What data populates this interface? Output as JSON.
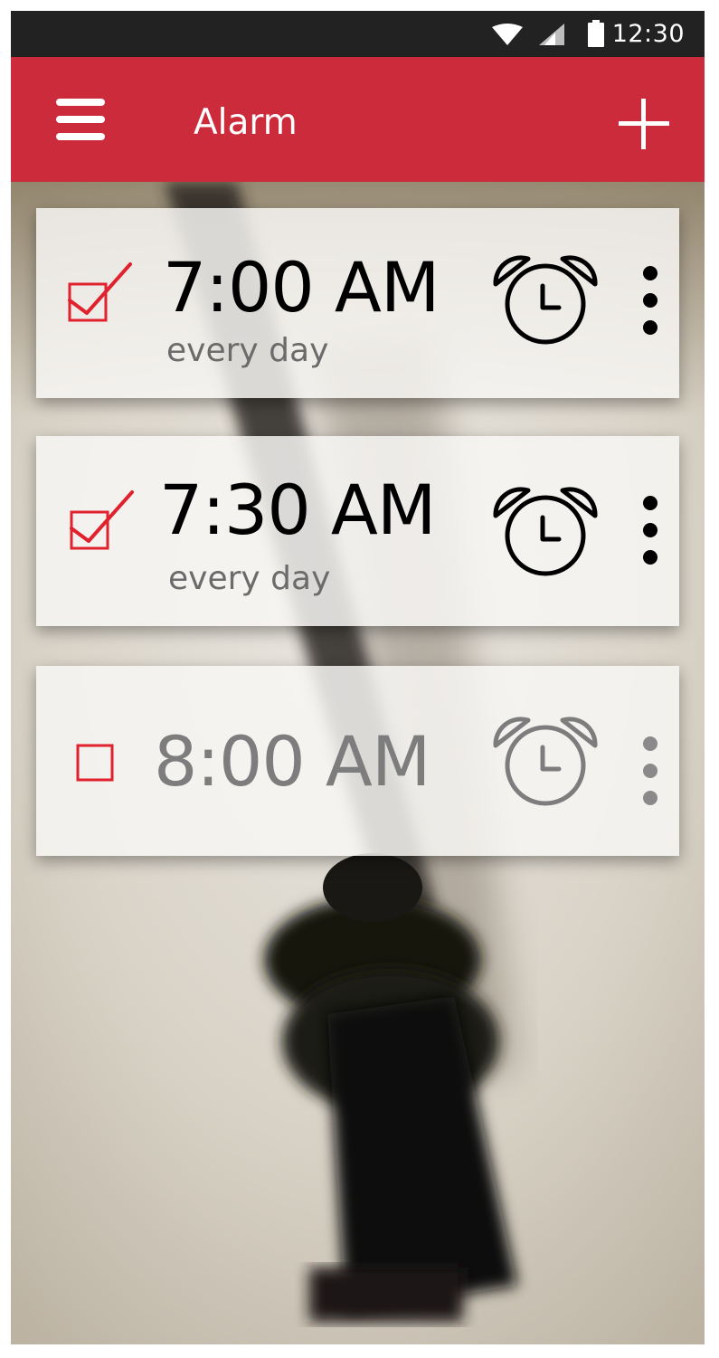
{
  "status_bar": {
    "time": "12:30",
    "icons": [
      "wifi-icon",
      "cell-signal-icon",
      "battery-icon"
    ]
  },
  "app_bar": {
    "title": "Alarm",
    "menu_icon": "hamburger-menu-icon",
    "add_icon": "plus-icon"
  },
  "colors": {
    "accent": "#cb2b3b",
    "checkbox": "#e0222f",
    "enabled_text": "#000000",
    "disabled_text": "#7d7d7d"
  },
  "alarms": [
    {
      "time": "7:00 AM",
      "repeat": "every day",
      "enabled": true,
      "icon": "alarm-clock-icon"
    },
    {
      "time": "7:30 AM",
      "repeat": "every day",
      "enabled": true,
      "icon": "alarm-clock-icon"
    },
    {
      "time": "8:00 AM",
      "repeat": "",
      "enabled": false,
      "icon": "alarm-clock-icon"
    }
  ]
}
